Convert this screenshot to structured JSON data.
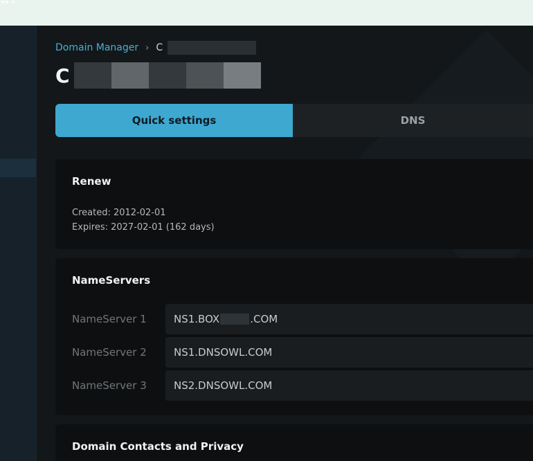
{
  "breadcrumb": {
    "root": "Domain Manager",
    "separator": "›",
    "current_prefix": "C"
  },
  "page": {
    "title_prefix": "C"
  },
  "tabs": [
    {
      "label": "Quick settings",
      "active": true
    },
    {
      "label": "DNS",
      "active": false
    }
  ],
  "renew": {
    "title": "Renew",
    "created": "Created: 2012-02-01",
    "expires": "Expires: 2027-02-01 (162 days)"
  },
  "nameservers": {
    "title": "NameServers",
    "rows": [
      {
        "label": "NameServer 1",
        "value_prefix": "NS1.BOX",
        "value_suffix": ".COM"
      },
      {
        "label": "NameServer 2",
        "value": "NS1.DNSOWL.COM"
      },
      {
        "label": "NameServer 3",
        "value": "NS2.DNSOWL.COM"
      }
    ]
  },
  "contacts": {
    "title": "Domain Contacts and Privacy"
  },
  "colors": {
    "accent": "#3ea8d1",
    "link": "#47b0d6",
    "card_bg": "#0e0f10",
    "page_bg": "#131719"
  }
}
